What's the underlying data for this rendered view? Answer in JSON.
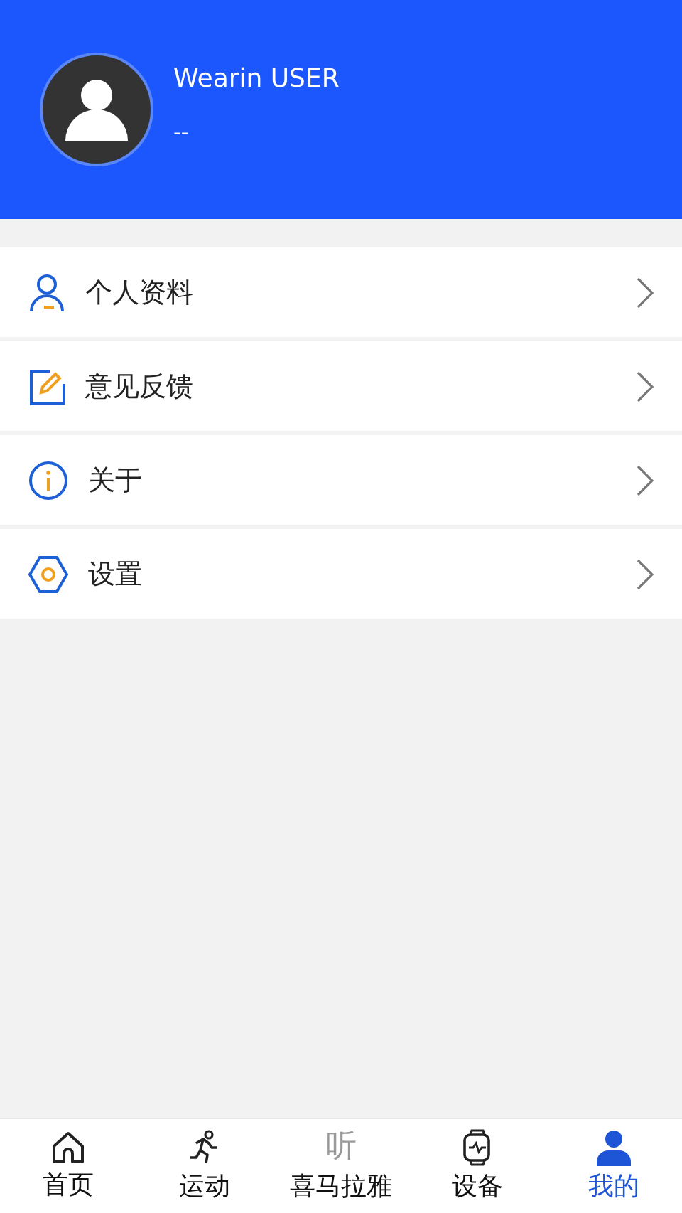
{
  "profile": {
    "name": "Wearin USER",
    "subtitle": "--"
  },
  "menu": [
    {
      "kind": "person",
      "label": "个人资料"
    },
    {
      "kind": "edit",
      "label": "意见反馈"
    },
    {
      "kind": "info",
      "label": "关于"
    },
    {
      "kind": "settings",
      "label": "设置"
    }
  ],
  "tab_bar": [
    {
      "kind": "home",
      "label": "首页",
      "selected": false
    },
    {
      "kind": "run",
      "label": "运动",
      "selected": false
    },
    {
      "kind": "glyph",
      "glyph": "听",
      "label": "喜马拉雅",
      "selected": false
    },
    {
      "kind": "watch",
      "label": "设备",
      "selected": false
    },
    {
      "kind": "user",
      "label": "我的",
      "selected": true
    }
  ]
}
